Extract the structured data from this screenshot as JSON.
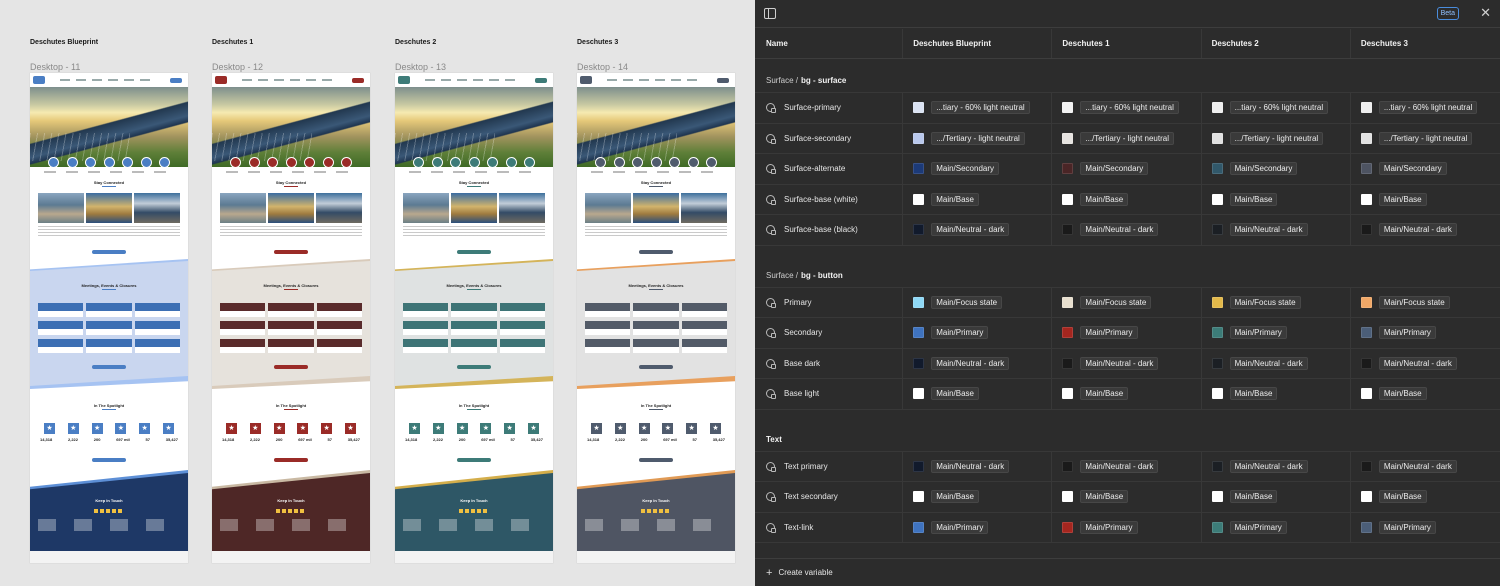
{
  "canvas": {
    "frames": [
      {
        "title": "Deschutes Blueprint",
        "label": "Desktop - 11",
        "accent": "#4a7ec4",
        "band": "#c9d6ef",
        "band_edge": "#a6c3f2",
        "dark": "#1e3866",
        "tile": "#3c6fb4",
        "edge2": "#5d8fd6",
        "stats": [
          "14,318",
          "2,222",
          "200",
          "697 mil",
          "57",
          "35,427"
        ]
      },
      {
        "title": "Deschutes 1",
        "label": "Desktop - 12",
        "accent": "#9a2b27",
        "band": "#e6e2dc",
        "band_edge": "#d9cbbb",
        "dark": "#4e2726",
        "tile": "#5a2b2b",
        "edge2": "#c9b9a3",
        "stats": [
          "14,318",
          "2,222",
          "200",
          "697 mil",
          "57",
          "35,427"
        ]
      },
      {
        "title": "Deschutes 2",
        "label": "Desktop - 13",
        "accent": "#3d7b78",
        "band": "#dfe2e2",
        "band_edge": "#d4b45a",
        "dark": "#2e5766",
        "tile": "#3e7476",
        "edge2": "#d4ae4b",
        "stats": [
          "14,318",
          "2,222",
          "200",
          "697 mil",
          "57",
          "35,427"
        ]
      },
      {
        "title": "Deschutes 3",
        "label": "Desktop - 14",
        "accent": "#4f5b6d",
        "band": "#e2e2e2",
        "band_edge": "#e8a05e",
        "dark": "#4f5563",
        "tile": "#535b68",
        "edge2": "#e09a55",
        "stats": [
          "14,318",
          "2,222",
          "200",
          "697 mil",
          "57",
          "35,427"
        ]
      }
    ],
    "sections": {
      "stay_connected": "Stay Connected",
      "meetings": "Meetings, Events & Closures",
      "spotlight": "In The Spotlight",
      "keep_in_touch": "Keep In Touch"
    }
  },
  "panel": {
    "beta_label": "Beta",
    "columns": [
      "Name",
      "Deschutes Blueprint",
      "Deschutes 1",
      "Deschutes 2",
      "Deschutes 3"
    ],
    "groups": [
      {
        "prefix": "Surface /",
        "title": "bg - surface",
        "rows": [
          {
            "name": "Surface-primary",
            "values": [
              {
                "color": "#dbe3f3",
                "label": "...tiary - 60% light neutral"
              },
              {
                "color": "#f2f2f2",
                "label": "...tiary - 60% light neutral"
              },
              {
                "color": "#eeeeee",
                "label": "...tiary - 60% light neutral"
              },
              {
                "color": "#eeeeee",
                "label": "...tiary - 60% light neutral"
              }
            ]
          },
          {
            "name": "Surface-secondary",
            "values": [
              {
                "color": "#b9c8ec",
                "label": ".../Tertiary - light neutral"
              },
              {
                "color": "#e6e3e0",
                "label": ".../Tertiary - light neutral"
              },
              {
                "color": "#e0e0e0",
                "label": ".../Tertiary - light neutral"
              },
              {
                "color": "#e2e2e2",
                "label": ".../Tertiary - light neutral"
              }
            ]
          },
          {
            "name": "Surface-alternate",
            "values": [
              {
                "color": "#1c3a78",
                "label": "Main/Secondary"
              },
              {
                "color": "#4a2526",
                "label": "Main/Secondary"
              },
              {
                "color": "#31586a",
                "label": "Main/Secondary"
              },
              {
                "color": "#4d5361",
                "label": "Main/Secondary"
              }
            ]
          },
          {
            "name": "Surface-base (white)",
            "values": [
              {
                "color": "#ffffff",
                "label": "Main/Base"
              },
              {
                "color": "#ffffff",
                "label": "Main/Base"
              },
              {
                "color": "#ffffff",
                "label": "Main/Base"
              },
              {
                "color": "#ffffff",
                "label": "Main/Base"
              }
            ]
          },
          {
            "name": "Surface-base (black)",
            "values": [
              {
                "color": "#111a2c",
                "label": "Main/Neutral - dark"
              },
              {
                "color": "#1a1a1a",
                "label": "Main/Neutral - dark"
              },
              {
                "color": "#1b1f24",
                "label": "Main/Neutral - dark"
              },
              {
                "color": "#1a1a1a",
                "label": "Main/Neutral - dark"
              }
            ]
          }
        ]
      },
      {
        "prefix": "Surface /",
        "title": "bg - button",
        "rows": [
          {
            "name": "Primary",
            "values": [
              {
                "color": "#8fd8f5",
                "label": "Main/Focus state"
              },
              {
                "color": "#e8dfcf",
                "label": "Main/Focus state"
              },
              {
                "color": "#e3b94a",
                "label": "Main/Focus state"
              },
              {
                "color": "#f1a867",
                "label": "Main/Focus state"
              }
            ]
          },
          {
            "name": "Secondary",
            "values": [
              {
                "color": "#3f73bf",
                "label": "Main/Primary"
              },
              {
                "color": "#a5261f",
                "label": "Main/Primary"
              },
              {
                "color": "#3c7c78",
                "label": "Main/Primary"
              },
              {
                "color": "#4b5e78",
                "label": "Main/Primary"
              }
            ]
          },
          {
            "name": "Base dark",
            "values": [
              {
                "color": "#111a2c",
                "label": "Main/Neutral - dark"
              },
              {
                "color": "#1a1a1a",
                "label": "Main/Neutral - dark"
              },
              {
                "color": "#1b1f24",
                "label": "Main/Neutral - dark"
              },
              {
                "color": "#1a1a1a",
                "label": "Main/Neutral - dark"
              }
            ]
          },
          {
            "name": "Base light",
            "values": [
              {
                "color": "#ffffff",
                "label": "Main/Base"
              },
              {
                "color": "#ffffff",
                "label": "Main/Base"
              },
              {
                "color": "#ffffff",
                "label": "Main/Base"
              },
              {
                "color": "#ffffff",
                "label": "Main/Base"
              }
            ]
          }
        ]
      },
      {
        "prefix": "",
        "title": "Text",
        "rows": [
          {
            "name": "Text primary",
            "values": [
              {
                "color": "#111a2c",
                "label": "Main/Neutral - dark"
              },
              {
                "color": "#1a1a1a",
                "label": "Main/Neutral - dark"
              },
              {
                "color": "#1b1f24",
                "label": "Main/Neutral - dark"
              },
              {
                "color": "#1a1a1a",
                "label": "Main/Neutral - dark"
              }
            ]
          },
          {
            "name": "Text secondary",
            "values": [
              {
                "color": "#ffffff",
                "label": "Main/Base"
              },
              {
                "color": "#ffffff",
                "label": "Main/Base"
              },
              {
                "color": "#ffffff",
                "label": "Main/Base"
              },
              {
                "color": "#ffffff",
                "label": "Main/Base"
              }
            ]
          },
          {
            "name": "Text-link",
            "values": [
              {
                "color": "#3f73bf",
                "label": "Main/Primary"
              },
              {
                "color": "#a5261f",
                "label": "Main/Primary"
              },
              {
                "color": "#3c7c78",
                "label": "Main/Primary"
              },
              {
                "color": "#4b5e78",
                "label": "Main/Primary"
              }
            ]
          }
        ]
      }
    ],
    "create_label": "Create variable"
  }
}
